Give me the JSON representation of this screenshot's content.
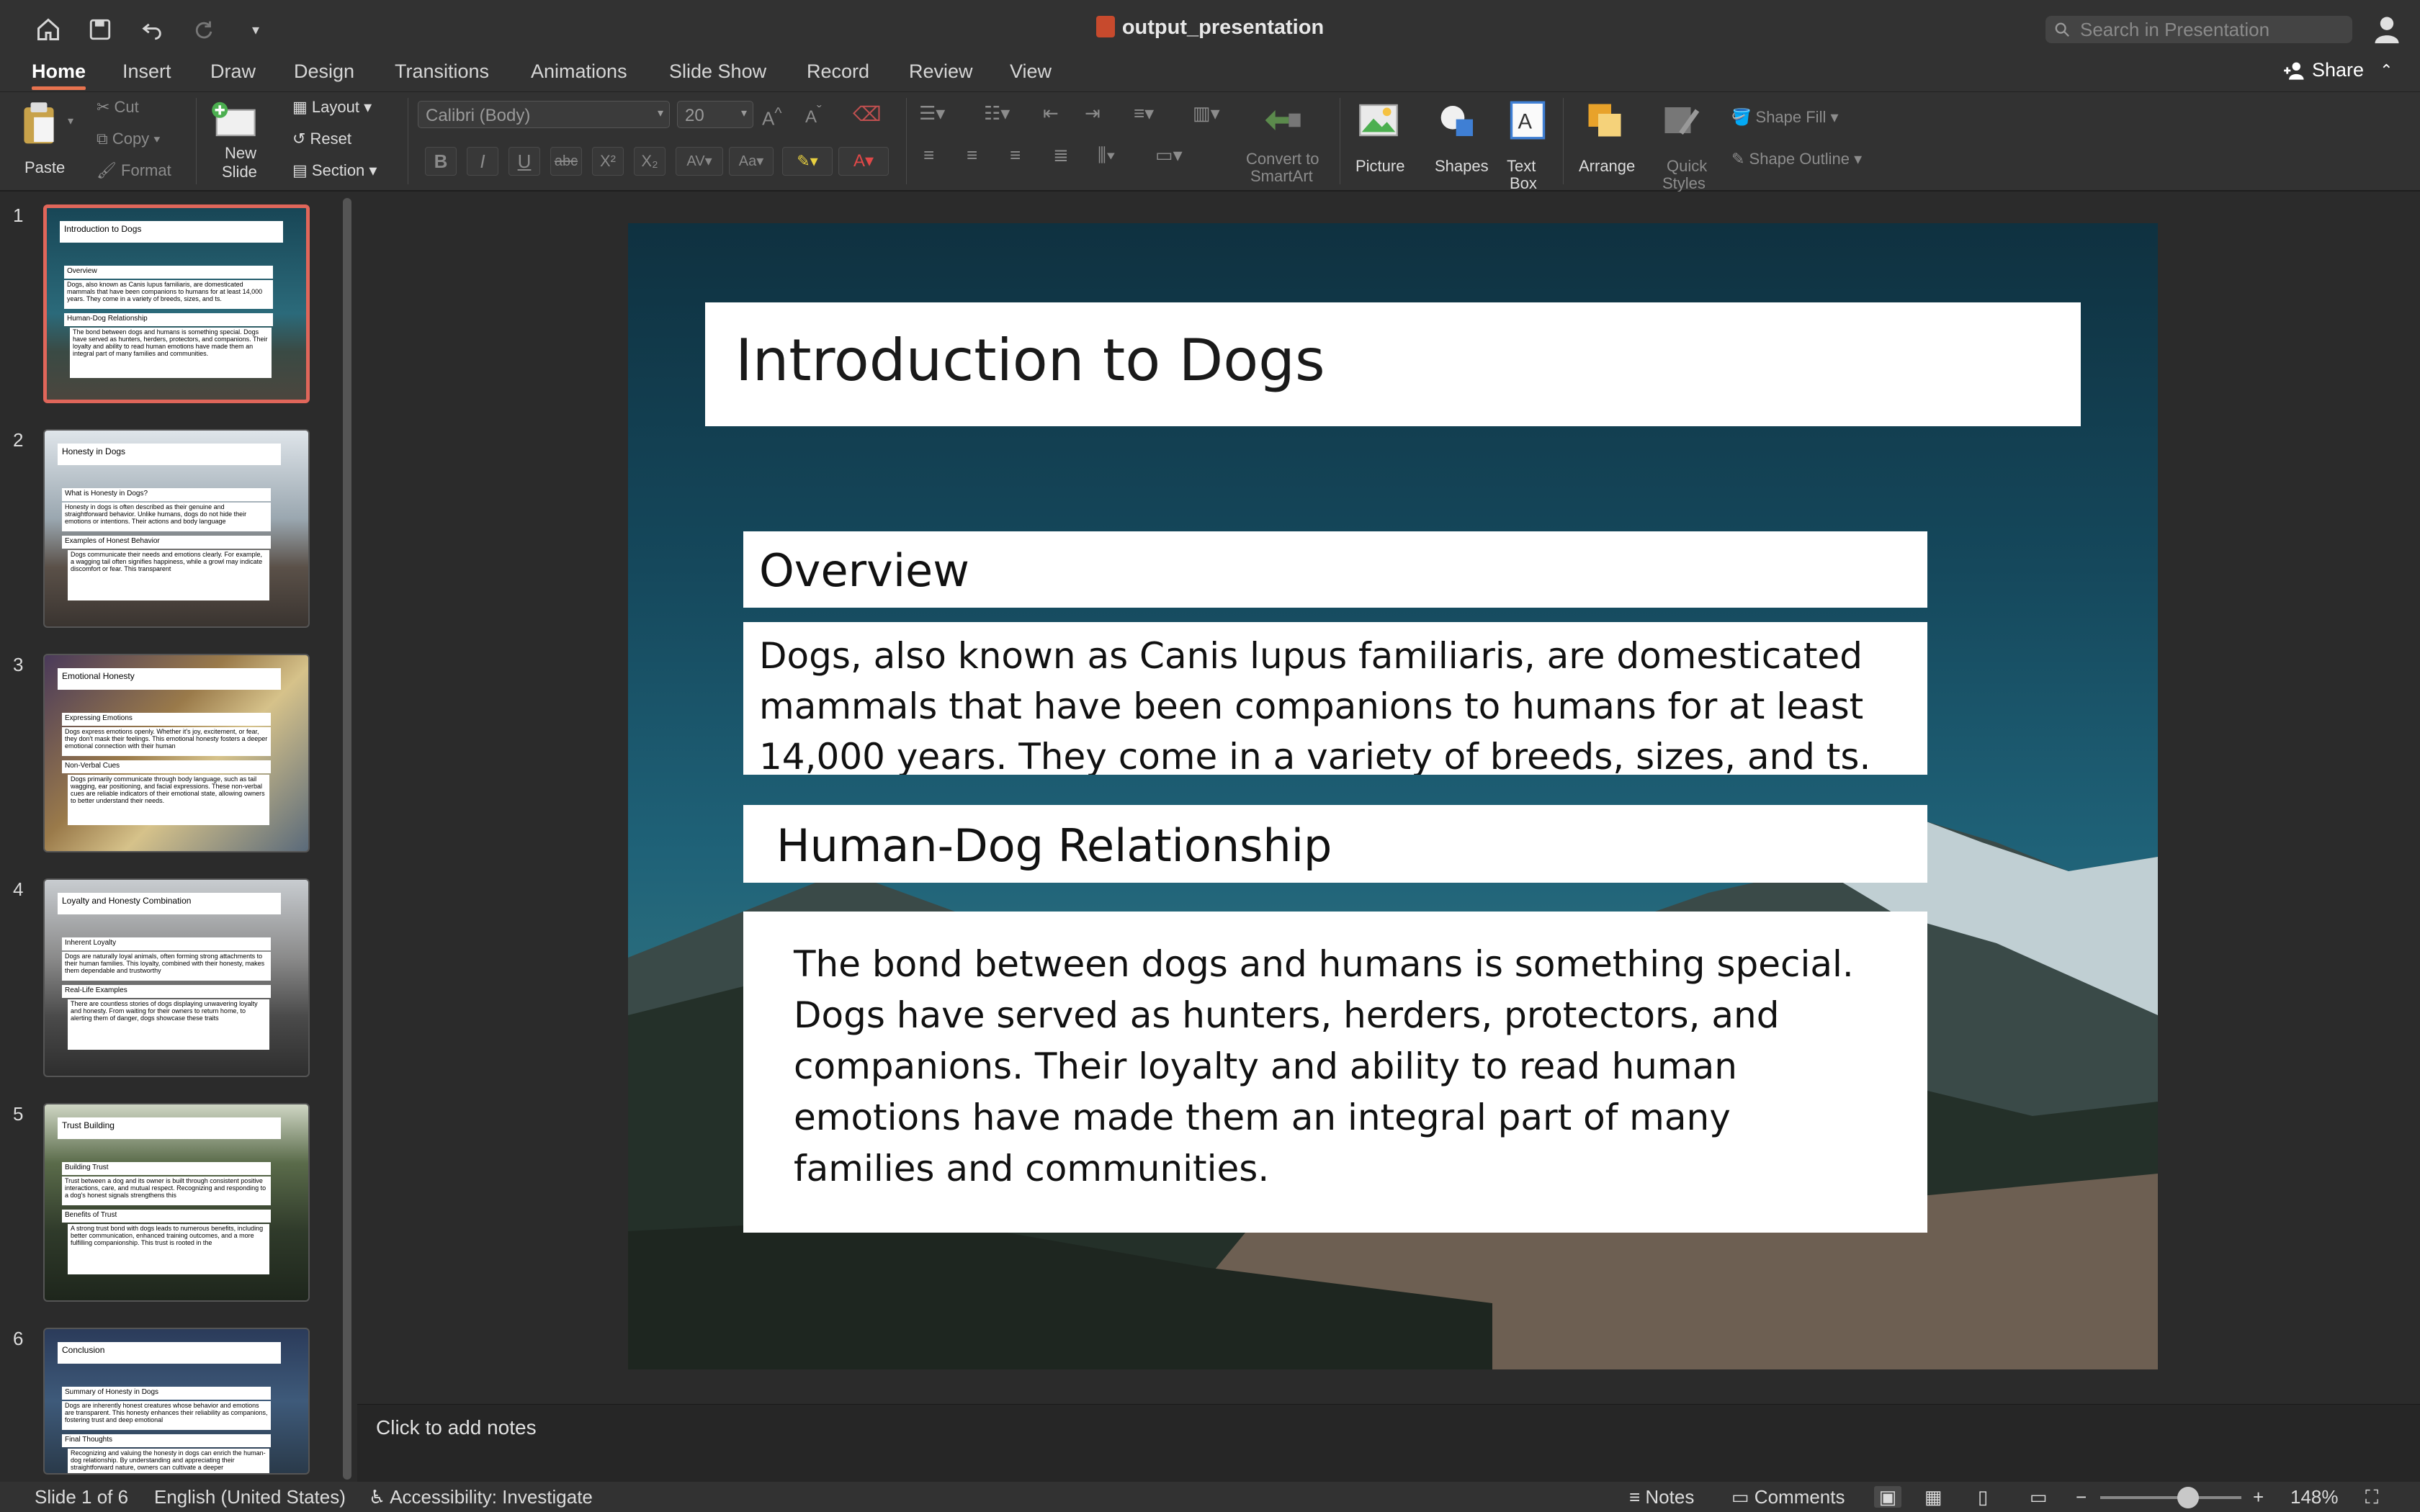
{
  "window": {
    "title": "output_presentation"
  },
  "search": {
    "placeholder": "Search in Presentation"
  },
  "tabs": [
    "Home",
    "Insert",
    "Draw",
    "Design",
    "Transitions",
    "Animations",
    "Slide Show",
    "Record",
    "Review",
    "View"
  ],
  "share_label": "Share",
  "ribbon": {
    "paste": "Paste",
    "cut": "Cut",
    "copy": "Copy",
    "format": "Format",
    "new_slide_1": "New",
    "new_slide_2": "Slide",
    "layout": "Layout",
    "reset": "Reset",
    "section": "Section",
    "font_name": "Calibri (Body)",
    "font_size": "20",
    "convert_1": "Convert to",
    "convert_2": "SmartArt",
    "picture": "Picture",
    "shapes": "Shapes",
    "textbox_1": "Text",
    "textbox_2": "Box",
    "arrange": "Arrange",
    "quick_1": "Quick",
    "quick_2": "Styles",
    "shape_fill": "Shape Fill",
    "shape_outline": "Shape Outline"
  },
  "thumbnails": [
    {
      "num": "1",
      "title": "Introduction to Dogs",
      "h1": "Overview",
      "t1": "Dogs, also known as Canis lupus familiaris, are domesticated mammals that have been companions to humans for at least 14,000 years. They come in a variety of breeds, sizes, and ts.",
      "h2": "Human-Dog Relationship",
      "t2": "The bond between dogs and humans is something special. Dogs have served as hunters, herders, protectors, and companions. Their loyalty and ability to read human emotions have made them an integral part of many families and communities."
    },
    {
      "num": "2",
      "title": "Honesty in Dogs",
      "h1": "What is Honesty in Dogs?",
      "t1": "Honesty in dogs is often described as their genuine and straightforward behavior. Unlike humans, dogs do not hide their emotions or intentions. Their actions and body language",
      "h2": "Examples of Honest Behavior",
      "t2": "Dogs communicate their needs and emotions clearly. For example, a wagging tail often signifies happiness, while a growl may indicate discomfort or fear. This transparent"
    },
    {
      "num": "3",
      "title": "Emotional Honesty",
      "h1": "Expressing Emotions",
      "t1": "Dogs express emotions openly. Whether it's joy, excitement, or fear, they don't mask their feelings. This emotional honesty fosters a deeper emotional connection with their human",
      "h2": "Non-Verbal Cues",
      "t2": "Dogs primarily communicate through body language, such as tail wagging, ear positioning, and facial expressions. These non-verbal cues are reliable indicators of their emotional state, allowing owners to better understand their needs."
    },
    {
      "num": "4",
      "title": "Loyalty and Honesty Combination",
      "h1": "Inherent Loyalty",
      "t1": "Dogs are naturally loyal animals, often forming strong attachments to their human families. This loyalty, combined with their honesty, makes them dependable and trustworthy",
      "h2": "Real-Life Examples",
      "t2": "There are countless stories of dogs displaying unwavering loyalty and honesty. From waiting for their owners to return home, to alerting them of danger, dogs showcase these traits"
    },
    {
      "num": "5",
      "title": "Trust Building",
      "h1": "Building Trust",
      "t1": "Trust between a dog and its owner is built through consistent positive interactions, care, and mutual respect. Recognizing and responding to a dog's honest signals strengthens this",
      "h2": "Benefits of Trust",
      "t2": "A strong trust bond with dogs leads to numerous benefits, including better communication, enhanced training outcomes, and a more fulfilling companionship. This trust is rooted in the"
    },
    {
      "num": "6",
      "title": "Conclusion",
      "h1": "Summary of Honesty in Dogs",
      "t1": "Dogs are inherently honest creatures whose behavior and emotions are transparent. This honesty enhances their reliability as companions, fostering trust and deep emotional",
      "h2": "Final Thoughts",
      "t2": "Recognizing and valuing the honesty in dogs can enrich the human-dog relationship. By understanding and appreciating their straightforward nature, owners can cultivate a deeper"
    }
  ],
  "slide": {
    "title": "Introduction to Dogs",
    "overview_heading": "Overview",
    "overview_text": "Dogs, also known as Canis lupus familiaris, are domesticated mammals that have been companions to humans for at least 14,000 years. They come in a variety of breeds, sizes, and ts.",
    "relationship_heading": "Human-Dog Relationship",
    "relationship_text": "The bond between dogs and humans is something special. Dogs have served as hunters, herders, protectors, and companions. Their loyalty and ability to read human emotions have made them an integral part of many families and communities."
  },
  "notes": {
    "placeholder": "Click to add notes"
  },
  "status": {
    "slide_info": "Slide 1 of 6",
    "language": "English (United States)",
    "accessibility": "Accessibility: Investigate",
    "notes": "Notes",
    "comments": "Comments",
    "zoom": "148%",
    "zoom_level": 0.62
  },
  "colors": {
    "accent": "#e8734f",
    "selection": "#e0665a"
  }
}
